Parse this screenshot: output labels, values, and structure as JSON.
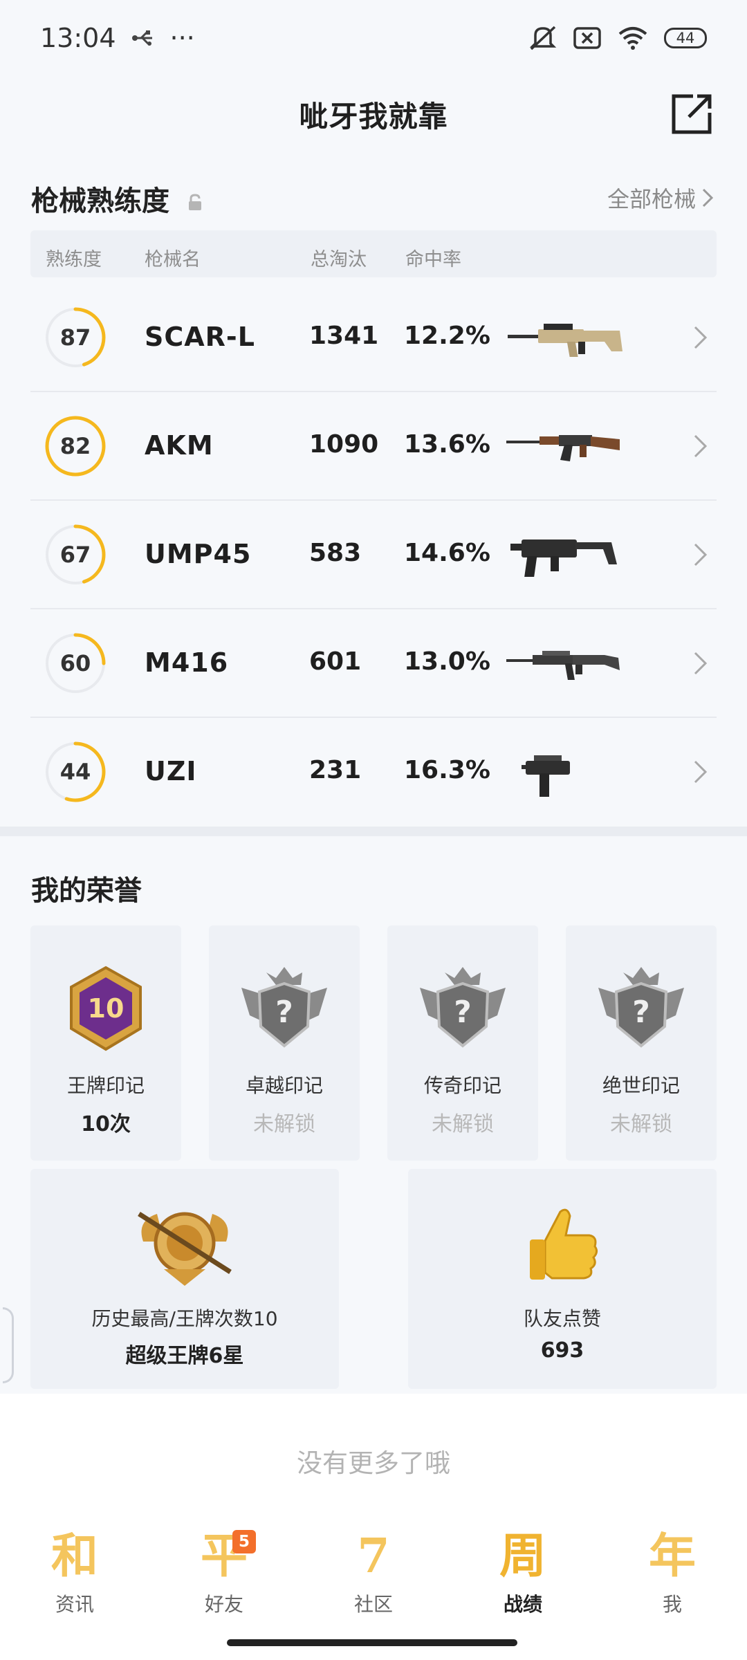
{
  "status_bar": {
    "time": "13:04",
    "dots": "···",
    "battery": "44"
  },
  "header": {
    "title": "呲牙我就靠"
  },
  "mastery": {
    "title": "枪械熟练度",
    "all_link": "全部枪械",
    "columns": [
      "熟练度",
      "枪械名",
      "总淘汰",
      "命中率"
    ],
    "rows": [
      {
        "level": "87",
        "progress": 0.45,
        "name": "SCAR-L",
        "kills": "1341",
        "accuracy": "12.2%",
        "icon": "scar-l-rifle-icon"
      },
      {
        "level": "82",
        "progress": 1.0,
        "name": "AKM",
        "kills": "1090",
        "accuracy": "13.6%",
        "icon": "akm-rifle-icon"
      },
      {
        "level": "67",
        "progress": 0.45,
        "name": "UMP45",
        "kills": "583",
        "accuracy": "14.6%",
        "icon": "ump45-smg-icon"
      },
      {
        "level": "60",
        "progress": 0.25,
        "name": "M416",
        "kills": "601",
        "accuracy": "13.0%",
        "icon": "m416-rifle-icon"
      },
      {
        "level": "44",
        "progress": 0.55,
        "name": "UZI",
        "kills": "231",
        "accuracy": "16.3%",
        "icon": "uzi-smg-icon"
      }
    ],
    "colors": {
      "ring": "#f5b81e",
      "ring_track": "#e8eaee"
    }
  },
  "honors": {
    "title": "我的荣誉",
    "cards": [
      {
        "label": "王牌印记",
        "value": "10次",
        "locked": false,
        "badge_text": "10",
        "icon": "ace-emblem-icon"
      },
      {
        "label": "卓越印记",
        "value": "未解锁",
        "locked": true,
        "icon": "locked-emblem-icon"
      },
      {
        "label": "传奇印记",
        "value": "未解锁",
        "locked": true,
        "icon": "locked-emblem-icon"
      },
      {
        "label": "绝世印记",
        "value": "未解锁",
        "locked": true,
        "icon": "locked-emblem-icon"
      }
    ],
    "wide_cards": [
      {
        "label": "历史最高/王牌次数10",
        "value": "超级王牌6星",
        "icon": "super-ace-badge-icon"
      },
      {
        "label": "队友点赞",
        "value": "693",
        "icon": "thumbs-up-icon"
      }
    ]
  },
  "footer": {
    "no_more": "没有更多了哦"
  },
  "nav": {
    "items": [
      {
        "glyph": "和",
        "label": "资讯",
        "badge": ""
      },
      {
        "glyph": "平",
        "label": "好友",
        "badge": "5"
      },
      {
        "glyph": "7",
        "label": "社区",
        "badge": ""
      },
      {
        "glyph": "周",
        "label": "战绩",
        "badge": ""
      },
      {
        "glyph": "年",
        "label": "我",
        "badge": ""
      }
    ],
    "active": "战绩"
  }
}
